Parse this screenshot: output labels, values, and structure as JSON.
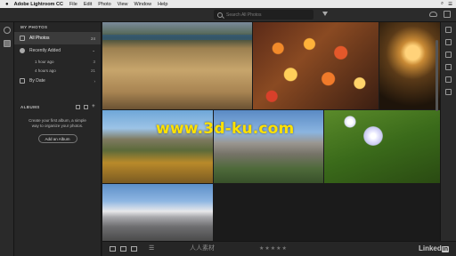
{
  "menubar": {
    "app_name": "Adobe Lightroom CC",
    "items": [
      "File",
      "Edit",
      "Photo",
      "View",
      "Window",
      "Help"
    ]
  },
  "toolbar": {
    "search_placeholder": "Search All Photos"
  },
  "sidebar": {
    "my_photos_header": "MY PHOTOS",
    "all_photos": {
      "label": "All Photos",
      "count": "24"
    },
    "recently_added": {
      "label": "Recently Added"
    },
    "recent_sub": [
      {
        "label": "1 hour ago",
        "count": "3"
      },
      {
        "label": "4 hours ago",
        "count": "21"
      }
    ],
    "by_date": {
      "label": "By Date"
    },
    "albums_header": "ALBUMS",
    "albums_message": "Create your first album, a simple way to organize your photos.",
    "add_album_label": "Add an Album"
  },
  "overlay": {
    "text": "www.3d-ku.com"
  },
  "bottombar": {
    "watermark": "人人素材",
    "stars": "★★★★★",
    "brand": "Linked",
    "brand_in": "in"
  },
  "colors": {
    "background": "#1c1c1c",
    "panel": "#262626",
    "overlay_text": "#ffe100"
  }
}
